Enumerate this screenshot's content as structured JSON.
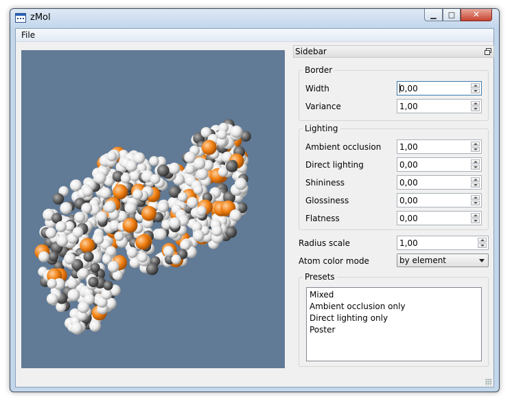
{
  "window": {
    "title": "zMol"
  },
  "menu": {
    "items": [
      {
        "label": "File"
      }
    ]
  },
  "sidebar": {
    "title": "Sidebar",
    "border": {
      "title": "Border",
      "fields": [
        {
          "label": "Width",
          "value": "0,00"
        },
        {
          "label": "Variance",
          "value": "1,00"
        }
      ]
    },
    "lighting": {
      "title": "Lighting",
      "fields": [
        {
          "label": "Ambient occlusion",
          "value": "1,00"
        },
        {
          "label": "Direct lighting",
          "value": "0,00"
        },
        {
          "label": "Shininess",
          "value": "0,00"
        },
        {
          "label": "Glossiness",
          "value": "0,00"
        },
        {
          "label": "Flatness",
          "value": "0,00"
        }
      ]
    },
    "radius_scale": {
      "label": "Radius scale",
      "value": "1,00"
    },
    "atom_color_mode": {
      "label": "Atom color mode",
      "value": "by element"
    },
    "presets": {
      "title": "Presets",
      "items": [
        "Mixed",
        "Ambient occlusion only",
        "Direct lighting only",
        "Poster"
      ]
    }
  },
  "viewport": {
    "background": "#617a96",
    "atom_colors": [
      "#ffffff",
      "#f07f10",
      "#606060"
    ]
  }
}
